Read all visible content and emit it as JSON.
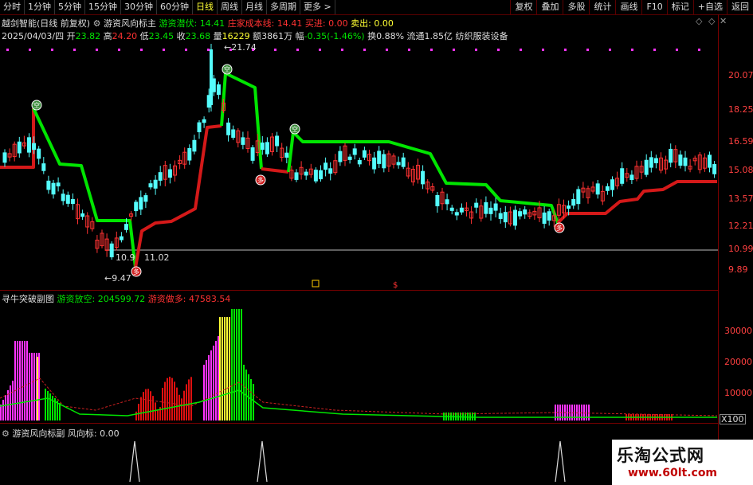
{
  "top_tabs": [
    "分时",
    "1分钟",
    "5分钟",
    "15分钟",
    "30分钟",
    "60分钟",
    "日线",
    "周线",
    "月线",
    "多周期",
    "更多 >"
  ],
  "active_tab": "日线",
  "right_tabs": [
    "复权",
    "叠加",
    "多股",
    "统计",
    "画线",
    "F10",
    "标记",
    "+自选",
    "返回"
  ],
  "info1": {
    "stock": "越剑智能(日线 前复权)",
    "indicator": "游资风向标主",
    "chaodi_label": "游资潜伏:",
    "chaodi_value": "14.41",
    "cost_label": "庄家成本线:",
    "cost_value": "14.41",
    "buy_label": "买进:",
    "buy_value": "0.00",
    "sell_label": "卖出:",
    "sell_value": "0.00"
  },
  "info2": {
    "date": "2025/04/03/四",
    "open_label": "开",
    "open": "23.82",
    "high_label": "高",
    "high": "24.20",
    "low_label": "低",
    "low": "23.45",
    "close_label": "收",
    "close": "23.68",
    "vol_label": "量",
    "vol": "16229",
    "amt_label": "额",
    "amt": "3861万",
    "chg_label": "幅",
    "chg": "-0.35(-1.46%)",
    "turn_label": "换",
    "turn": "0.88%",
    "float_label": "流通",
    "float": "1.85亿",
    "sector": "纺织服装设备"
  },
  "main_axis": [
    "20.07",
    "18.25",
    "16.59",
    "15.08",
    "13.57",
    "12.21",
    "10.99",
    "9.89"
  ],
  "annotations": {
    "high_mark": "21.74",
    "low_mark": "9.47",
    "low_line_left": "10.9",
    "low_line_right": "11.02"
  },
  "signal_icon_top": "空",
  "signal_icon_bottom": "多",
  "panel2": {
    "title": "寻牛突破副图",
    "green_label": "游资放空:",
    "green_value": "204599.72",
    "red_label": "游资做多:",
    "red_value": "47583.54",
    "axis": [
      "30000",
      "20000",
      "10000"
    ],
    "unit": "X100"
  },
  "panel3": {
    "title": "游资风向标副",
    "label": "风向标:",
    "value": "0.00"
  },
  "watermark": {
    "line1": "乐淘公式网",
    "line2": "www.60lt.com"
  },
  "colors": {
    "up": "#ff3232",
    "down": "#54fcfc",
    "green_line": "#00e600",
    "red_line": "#d41919",
    "bg": "#000000"
  }
}
